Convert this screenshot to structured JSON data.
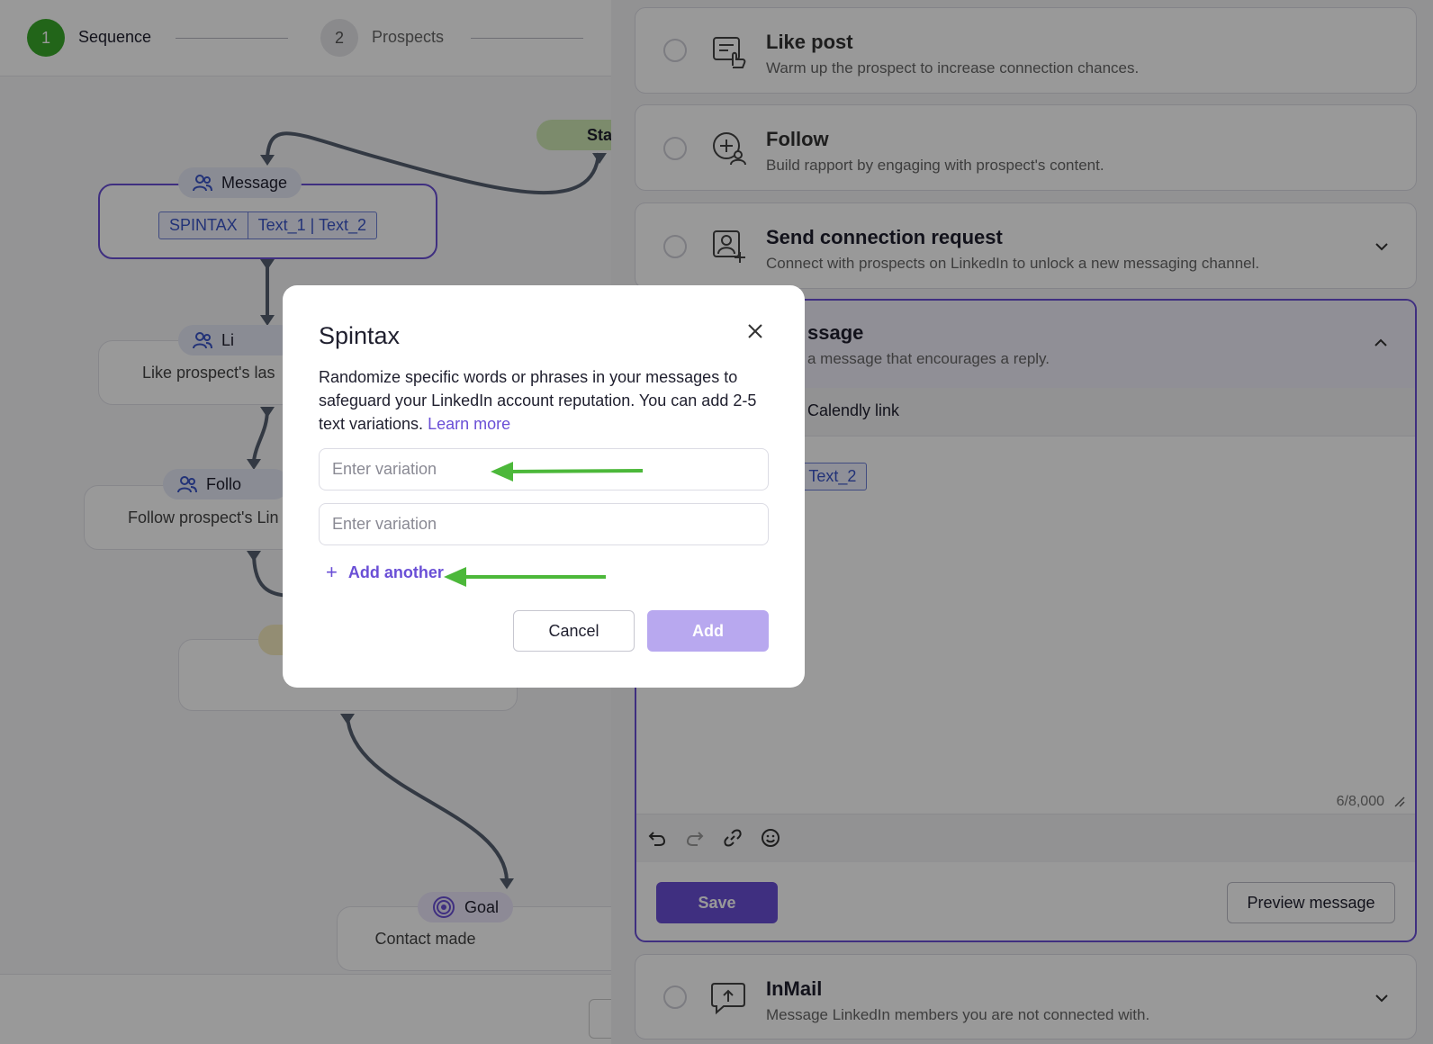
{
  "stepper": {
    "steps": [
      {
        "number": "1",
        "label": "Sequence"
      },
      {
        "number": "2",
        "label": "Prospects"
      }
    ]
  },
  "canvas": {
    "start_label": "Star",
    "message_node": {
      "label": "Message",
      "tag_key": "SPINTAX",
      "tag_value": "Text_1 | Text_2"
    },
    "like_node": {
      "label": "Li",
      "text": "Like prospect's las"
    },
    "follow_node": {
      "label": "Follo",
      "text": "Follow prospect's Lin"
    },
    "goal_node": {
      "label": "Goal",
      "text": "Contact made"
    }
  },
  "actions": {
    "like_post": {
      "title": "Like post",
      "desc": "Warm up the prospect to increase connection chances."
    },
    "follow": {
      "title": "Follow",
      "desc": "Build rapport by engaging with prospect's content."
    },
    "connection": {
      "title": "Send connection request",
      "desc": "Connect with prospects on LinkedIn to unlock a new messaging channel."
    },
    "message": {
      "title_partial": "ssage",
      "desc_partial": "a message that encourages a reply.",
      "toolbar_item": "Calendly link",
      "tag_partial": "| Text_2",
      "counter": "6/8,000",
      "save_label": "Save",
      "preview_label": "Preview message"
    },
    "inmail": {
      "title": "InMail",
      "desc": "Message LinkedIn members you are not connected with."
    }
  },
  "modal": {
    "title": "Spintax",
    "desc": "Randomize specific words or phrases in your messages to safeguard your LinkedIn account reputation. You can add 2-5 text variations.",
    "learn_more": "Learn more",
    "variation_placeholder": "Enter variation",
    "add_another": "Add another",
    "cancel": "Cancel",
    "add": "Add"
  },
  "colors": {
    "accent": "#6a4fd6",
    "step_active": "#3aa82a",
    "annotation_arrow": "#4cb83a"
  },
  "icons": [
    "close-icon",
    "plus-icon",
    "undo-icon",
    "redo-icon",
    "link-icon",
    "emoji-icon",
    "chevron-down-icon",
    "chevron-up-icon",
    "users-icon",
    "target-icon"
  ]
}
